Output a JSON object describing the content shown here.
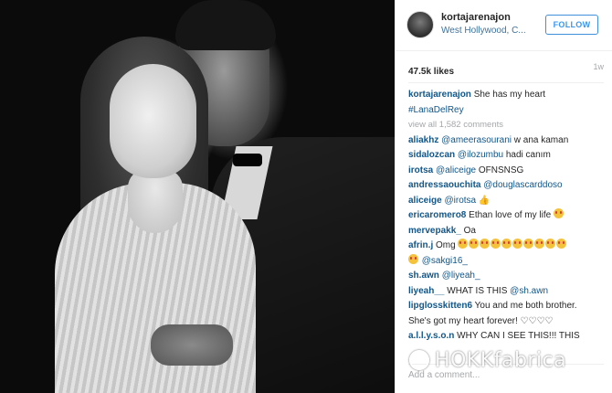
{
  "post": {
    "username": "kortajarenajon",
    "location": "West Hollywood, C...",
    "follow_label": "FOLLOW",
    "likes": "47.5k likes",
    "time": "1w",
    "caption_user": "kortajarenajon",
    "caption_text": "She has my heart",
    "caption_tag": "#LanaDelRey",
    "view_all": "view all 1,582 comments",
    "add_comment_placeholder": "Add a comment..."
  },
  "comments": [
    {
      "user": "aliakhz",
      "mention": "@ameerasourani",
      "text": "w ana kaman"
    },
    {
      "user": "sidalozcan",
      "mention": "@ilozumbu",
      "text": "hadi canım"
    },
    {
      "user": "irotsa",
      "mention": "@aliceige",
      "text": "OFNSNSG"
    },
    {
      "user": "andressaouchita",
      "mention": "@douglascarddoso",
      "text": ""
    },
    {
      "user": "aliceige",
      "mention": "@irotsa",
      "text": ""
    },
    {
      "user": "ericaromero8",
      "mention": "",
      "text": "Ethan love of my life"
    },
    {
      "user": "mervepakk_",
      "mention": "",
      "text": "Oa"
    },
    {
      "user": "afrin.j",
      "mention": "",
      "text": "Omg"
    },
    {
      "user": "",
      "mention": "@sakgi16_",
      "text": ""
    },
    {
      "user": "sh.awn",
      "mention": "@liyeah_",
      "text": ""
    },
    {
      "user": "liyeah__",
      "mention": "",
      "text": "WHAT IS THIS"
    },
    {
      "user": "",
      "mention": "@sh.awn",
      "text": ""
    },
    {
      "user": "lipglosskitten6",
      "mention": "",
      "text": "You and me both brother."
    },
    {
      "user": "",
      "mention": "",
      "text": "She's got my heart forever! ♡♡♡♡"
    },
    {
      "user": "a.l.l.y.s.o.n",
      "mention": "",
      "text": "WHY CAN I SEE THIS!!! THIS"
    }
  ],
  "watermark": {
    "text": "HOKKfabrica"
  },
  "icons": {
    "avatar": "profile-avatar",
    "emoji": "heart-eyes-emoji"
  }
}
